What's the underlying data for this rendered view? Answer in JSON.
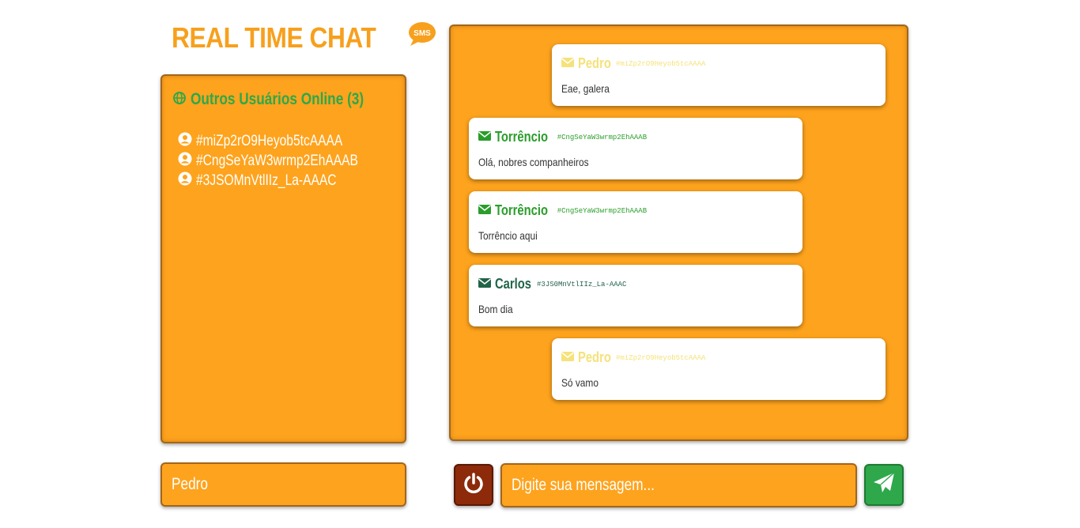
{
  "app": {
    "title": "REAL TIME CHAT",
    "title_icon": "sms-bubble-icon",
    "title_icon_text": "SMS",
    "accent_color": "#fea31d",
    "green_color": "#2ea84a"
  },
  "users_panel": {
    "heading": "Outros Usuários Online (3)",
    "heading_icon": "globe-icon",
    "users": [
      {
        "id": "#miZp2rO9Heyob5tcAAAA",
        "icon": "user-circle-icon"
      },
      {
        "id": "#CngSeYaW3wrmp2EhAAAB",
        "icon": "user-circle-icon"
      },
      {
        "id": "#3JSOMnVtlIIz_La-AAAC",
        "icon": "user-circle-icon"
      }
    ]
  },
  "messages": [
    {
      "author": "Pedro",
      "author_id": "#miZp2rO9Heyob5tcAAAA",
      "text": "Eae, galera",
      "self": true,
      "icon": "envelope-icon",
      "color": "#f5e27a"
    },
    {
      "author": "Torrêncio",
      "author_id": "#CngSeYaW3wrmp2EhAAAB",
      "text": "Olá, nobres companheiros",
      "self": false,
      "icon": "envelope-icon",
      "color": "#2a9d2a"
    },
    {
      "author": "Torrêncio",
      "author_id": "#CngSeYaW3wrmp2EhAAAB",
      "text": "Torrêncio aqui",
      "self": false,
      "icon": "envelope-icon",
      "color": "#2a9d2a"
    },
    {
      "author": "Carlos",
      "author_id": "#3JS0MnVtlIIz_La-AAAC",
      "text": "Bom dia",
      "self": false,
      "icon": "envelope-icon",
      "color": "#22634a"
    },
    {
      "author": "Pedro",
      "author_id": "#miZp2rO9Heyob5tcAAAA",
      "text": "Só vamo",
      "self": true,
      "icon": "envelope-icon",
      "color": "#f5e27a"
    }
  ],
  "footer": {
    "name_value": "Pedro",
    "message_placeholder": "Digite sua mensagem...",
    "power_icon": "power-icon",
    "send_icon": "paper-plane-icon"
  }
}
